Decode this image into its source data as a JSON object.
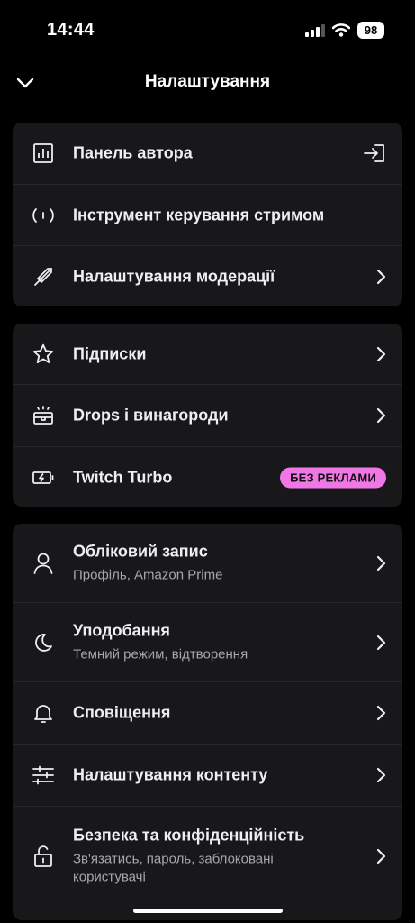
{
  "status": {
    "time": "14:44",
    "battery": "98"
  },
  "header": {
    "title": "Налаштування"
  },
  "cards": [
    {
      "rows": [
        {
          "label": "Панель автора"
        },
        {
          "label": "Інструмент керування стримом"
        },
        {
          "label": "Налаштування модерації"
        }
      ]
    },
    {
      "rows": [
        {
          "label": "Підписки"
        },
        {
          "label": "Drops і винагороди"
        },
        {
          "label": "Twitch Turbo",
          "badge": "БЕЗ РЕКЛАМИ"
        }
      ]
    },
    {
      "rows": [
        {
          "label": "Обліковий запис",
          "sub": "Профіль, Amazon Prime"
        },
        {
          "label": "Уподобання",
          "sub": "Темний режим, відтворення"
        },
        {
          "label": "Сповіщення"
        },
        {
          "label": "Налаштування контенту"
        },
        {
          "label": "Безпека та конфіденційність",
          "sub": "Зв'язатись, пароль, заблоковані користувачі"
        }
      ]
    }
  ],
  "colors": {
    "background": "#000000",
    "card": "#18181b",
    "badge": "#f277e6"
  }
}
